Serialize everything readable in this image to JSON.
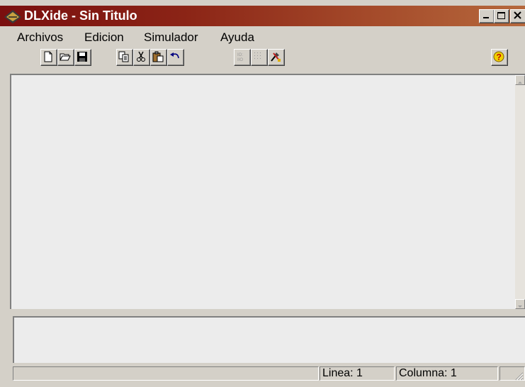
{
  "window": {
    "title": "DLXide - Sin Titulo",
    "title_gradient": [
      "#7a0f0f",
      "#b6683c"
    ]
  },
  "caption_buttons": [
    "minimize-icon",
    "maximize-icon",
    "close-icon"
  ],
  "menu": {
    "items": [
      {
        "label": "Archivos"
      },
      {
        "label": "Edicion"
      },
      {
        "label": "Simulador"
      },
      {
        "label": "Ayuda"
      }
    ]
  },
  "toolbar": {
    "buttons": [
      {
        "icon": "new-file-icon",
        "enabled": true
      },
      {
        "icon": "open-folder-icon",
        "enabled": true
      },
      {
        "icon": "save-icon",
        "enabled": true
      },
      {
        "icon": "copy-icon",
        "enabled": true
      },
      {
        "icon": "cut-icon",
        "enabled": true
      },
      {
        "icon": "paste-icon",
        "enabled": true
      },
      {
        "icon": "undo-icon",
        "enabled": true
      },
      {
        "icon": "io-icon",
        "enabled": false
      },
      {
        "icon": "grid-icon",
        "enabled": false
      },
      {
        "icon": "tools-icon",
        "enabled": true
      },
      {
        "icon": "help-icon",
        "enabled": true
      }
    ]
  },
  "statusbar": {
    "line_label": "Linea: 1",
    "column_label": "Columna: 1"
  }
}
